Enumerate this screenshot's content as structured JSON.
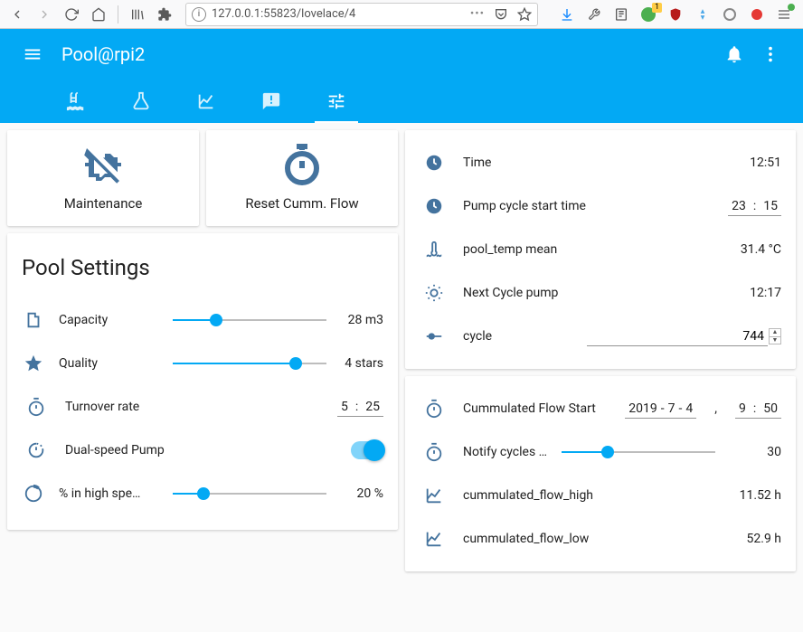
{
  "browser": {
    "url": "127.0.0.1:55823/lovelace/4"
  },
  "header": {
    "title": "Pool@rpi2"
  },
  "buttons": {
    "maintenance": "Maintenance",
    "reset_flow": "Reset Cumm. Flow"
  },
  "settings": {
    "title": "Pool Settings",
    "capacity": {
      "label": "Capacity",
      "value": "28 m3",
      "pct": 28
    },
    "quality": {
      "label": "Quality",
      "value": "4 stars",
      "pct": 80
    },
    "turnover": {
      "label": "Turnover rate",
      "h": "5",
      "m": "25"
    },
    "dual_speed": {
      "label": "Dual-speed Pump",
      "on": true
    },
    "high_speed": {
      "label": "% in high spe…",
      "value": "20 %",
      "pct": 20
    }
  },
  "status": {
    "time": {
      "label": "Time",
      "value": "12:51"
    },
    "cycle_start": {
      "label": "Pump cycle start time",
      "h": "23",
      "m": "15"
    },
    "pool_temp": {
      "label": "pool_temp mean",
      "value": "31.4 °C"
    },
    "next_cycle": {
      "label": "Next Cycle pump",
      "value": "12:17"
    },
    "cycle": {
      "label": "cycle",
      "value": "744"
    }
  },
  "flow": {
    "start": {
      "label": "Cummulated Flow Start",
      "y": "2019",
      "mo": "7",
      "d": "4",
      "h": "9",
      "m": "50"
    },
    "notify": {
      "label": "Notify cycles …",
      "value": "30",
      "pct": 30
    },
    "high": {
      "label": "cummulated_flow_high",
      "value": "11.52 h"
    },
    "low": {
      "label": "cummulated_flow_low",
      "value": "52.9 h"
    }
  }
}
